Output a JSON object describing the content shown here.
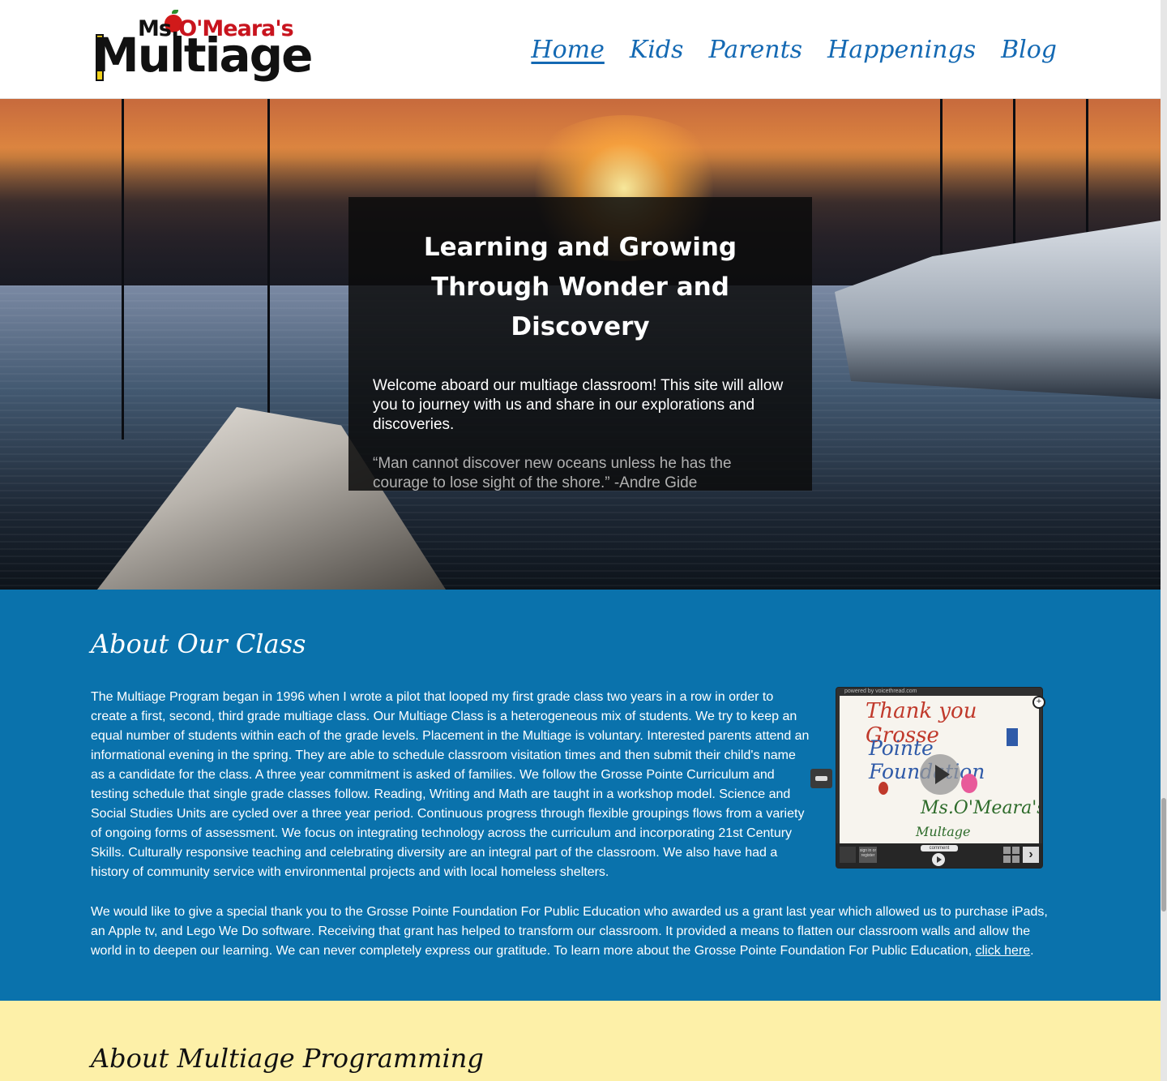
{
  "logo": {
    "ms": "Ms.",
    "omeara": "O'Meara's",
    "multiage": "Multiage"
  },
  "nav": {
    "items": [
      {
        "label": "Home",
        "active": true
      },
      {
        "label": "Kids",
        "active": false
      },
      {
        "label": "Parents",
        "active": false
      },
      {
        "label": "Happenings",
        "active": false
      },
      {
        "label": "Blog",
        "active": false
      }
    ]
  },
  "hero": {
    "title": "Learning and Growing Through Wonder and Discovery",
    "welcome": "Welcome aboard our multiage classroom! This site will allow you to journey with us and share in our explorations and discoveries.",
    "quote": "“Man cannot discover new oceans unless he has the courage to lose sight of the shore.” -Andre Gide"
  },
  "about": {
    "heading": "About Our Class",
    "paragraph1": "The Multiage Program began in 1996 when I wrote a pilot that looped my first grade class two years in a row in order to create a first, second, third grade multiage class. Our Multiage Class is a heterogeneous mix of students. We try to keep an equal number of students within each of the grade levels. Placement in the Multiage is voluntary. Interested parents attend an informational evening in the spring. They are able to schedule classroom visitation times and then submit their child's name as a candidate for the class. A three year commitment is asked of families. We follow the Grosse Pointe Curriculum and testing schedule that single grade classes follow. Reading, Writing and Math are taught in a workshop model. Science and Social Studies Units are cycled over a three year period. Continuous progress through flexible groupings flows from a variety of ongoing forms of assessment. We focus on integrating technology across the curriculum and incorporating 21st Century Skills. Culturally responsive teaching and celebrating diversity are an integral part of the classroom. We also have had a history of community service with environmental projects and with local homeless shelters.",
    "paragraph2": "We would like to give a special thank you to the Grosse Pointe Foundation For Public Education who awarded us a grant last year which allowed us to purchase iPads, an Apple tv, and Lego We Do software. Receiving that grant has helped to transform our classroom. It provided a means to flatten our classroom walls and allow the world in to deepen our learning. We can never completely express our gratitude.  To learn more about the Grosse Pointe Foundation For Public Education, ",
    "link_text": "click here",
    "paragraph2_end": "."
  },
  "voicethread": {
    "powered": "powered by voicethread.com",
    "line1": "Thank you Grosse",
    "line2": "Pointe Foundation",
    "line3": "Ms.O'Meara's",
    "line4": "Multage",
    "signin": "sign in or register",
    "comment": "comment"
  },
  "multiage": {
    "heading": "About Multiage Programming"
  },
  "colors": {
    "nav_link": "#1469b3",
    "about_bg": "#0a72ac",
    "multiage_bg": "#fdf0a8"
  }
}
